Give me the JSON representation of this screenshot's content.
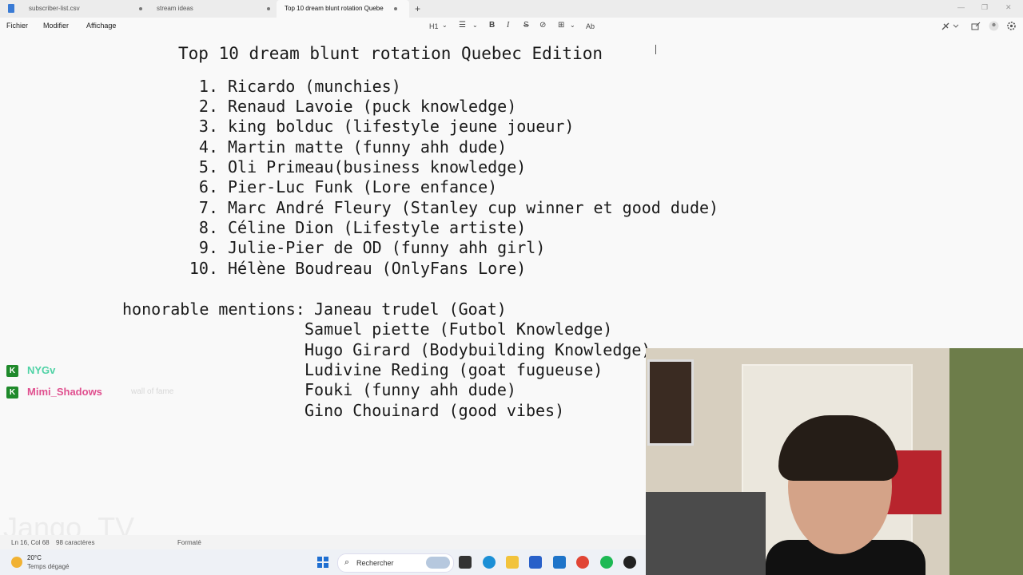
{
  "tabs": [
    {
      "label": "subscriber-list.csv",
      "active": false
    },
    {
      "label": "stream ideas",
      "active": false
    },
    {
      "label": "Top 10 dream blunt rotation Quebe",
      "active": true
    }
  ],
  "window_controls": {
    "minimize": "—",
    "restore": "❐",
    "close": "✕"
  },
  "new_tab": "+",
  "menu": [
    "Fichier",
    "Modifier",
    "Affichage"
  ],
  "toolbar": {
    "heading": "H1",
    "list": "☰",
    "bold": "B",
    "italic": "I",
    "strike": "S",
    "link": "⊘",
    "table": "⊞",
    "spell": "Ab",
    "chevron": "⌄"
  },
  "document": {
    "title": "Top 10 dream blunt rotation Quebec Edition",
    "items": [
      {
        "num": "1.",
        "text": "Ricardo (munchies)"
      },
      {
        "num": "2.",
        "text": "Renaud Lavoie (puck knowledge)"
      },
      {
        "num": "3.",
        "text": "king bolduc (lifestyle jeune joueur)"
      },
      {
        "num": "4.",
        "text": "Martin matte (funny ahh dude)"
      },
      {
        "num": "5.",
        "text": "Oli Primeau(business knowledge)"
      },
      {
        "num": "6.",
        "text": "Pier-Luc Funk (Lore enfance)"
      },
      {
        "num": "7.",
        "text": "Marc André Fleury (Stanley cup winner et good dude)"
      },
      {
        "num": "8.",
        "text": "Céline Dion (Lifestyle artiste)"
      },
      {
        "num": "9.",
        "text": "Julie-Pier de OD (funny ahh girl)"
      },
      {
        "num": "10.",
        "text": "Hélène Boudreau (OnlyFans Lore)"
      }
    ],
    "honorable_label": "honorable mentions:",
    "honorable": [
      "Janeau trudel (Goat)",
      "Samuel piette (Futbol Knowledge)",
      "Hugo Girard (Bodybuilding Knowledge)",
      "Ludivine Reding (goat fugueuse)",
      "Fouki (funny ahh dude)",
      "Gino Chouinard (good vibes)"
    ]
  },
  "chat": [
    {
      "name": "NYGv",
      "message": "",
      "color": "#4fd2a5"
    },
    {
      "name": "Mimi_Shadows",
      "message": "wall of fame",
      "color": "#e0508f"
    }
  ],
  "watermark": "Jango_TV",
  "status": {
    "position": "Ln 16, Col 68",
    "chars": "98 caractères",
    "format": "Formaté"
  },
  "taskbar": {
    "temperature": "20°C",
    "weather": "Temps dégagé",
    "search_placeholder": "Rechercher"
  },
  "colors": {
    "accent": "#1f6fd1",
    "chat_icon": "#1f8a2b"
  }
}
